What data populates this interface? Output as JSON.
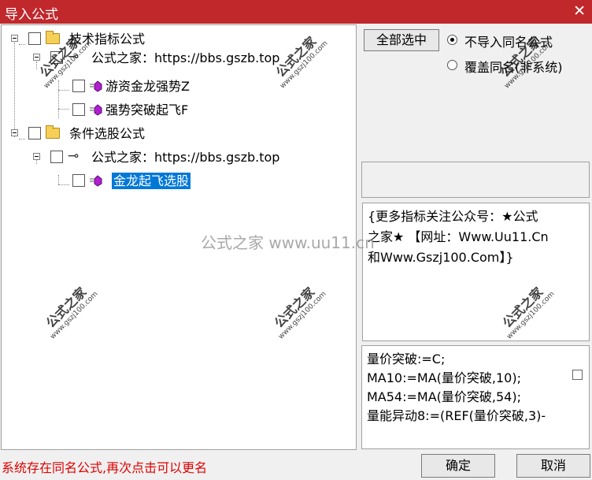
{
  "window": {
    "title": "导入公式",
    "close_glyph": "✕"
  },
  "tree": {
    "nodes": [
      {
        "label": "技术指标公式"
      },
      {
        "label": "公式之家：https://bbs.gszb.top"
      },
      {
        "label": "游资金龙强势Z"
      },
      {
        "label": "强势突破起飞F"
      },
      {
        "label": "条件选股公式"
      },
      {
        "label": "公式之家：https://bbs.gszb.top"
      },
      {
        "label": "金龙起飞选股"
      }
    ],
    "icons": {
      "folder": "folder-icon",
      "link": "link-icon",
      "formula": "formula-icon"
    }
  },
  "options": {
    "select_all_label": "全部选中",
    "radio_no_import": "不导入同名公式",
    "radio_overwrite": "覆盖同名(非系统)",
    "selected": "no_import"
  },
  "description": {
    "lines": [
      "{更多指标关注公众号：★公式",
      "之家★ 【网址：Www.Uu11.Cn",
      "和Www.Gszj100.Com】}"
    ]
  },
  "code": {
    "lines": [
      "量价突破:=C;",
      "MA10:=MA(量价突破,10);",
      "MA54:=MA(量价突破,54);",
      "量能异动8:=(REF(量价突破,3)-"
    ]
  },
  "status_text": "系统存在同名公式,再次点击可以更名",
  "buttons": {
    "ok": "确定",
    "cancel": "取消"
  },
  "watermarks": {
    "center": "公式之家 www.uu11.cn",
    "stamp_title": "公式之家",
    "stamp_url": "www.gszj100.com"
  },
  "colors": {
    "titlebar": "#c0282c",
    "status": "#e00000",
    "selection": "#0078d7"
  }
}
